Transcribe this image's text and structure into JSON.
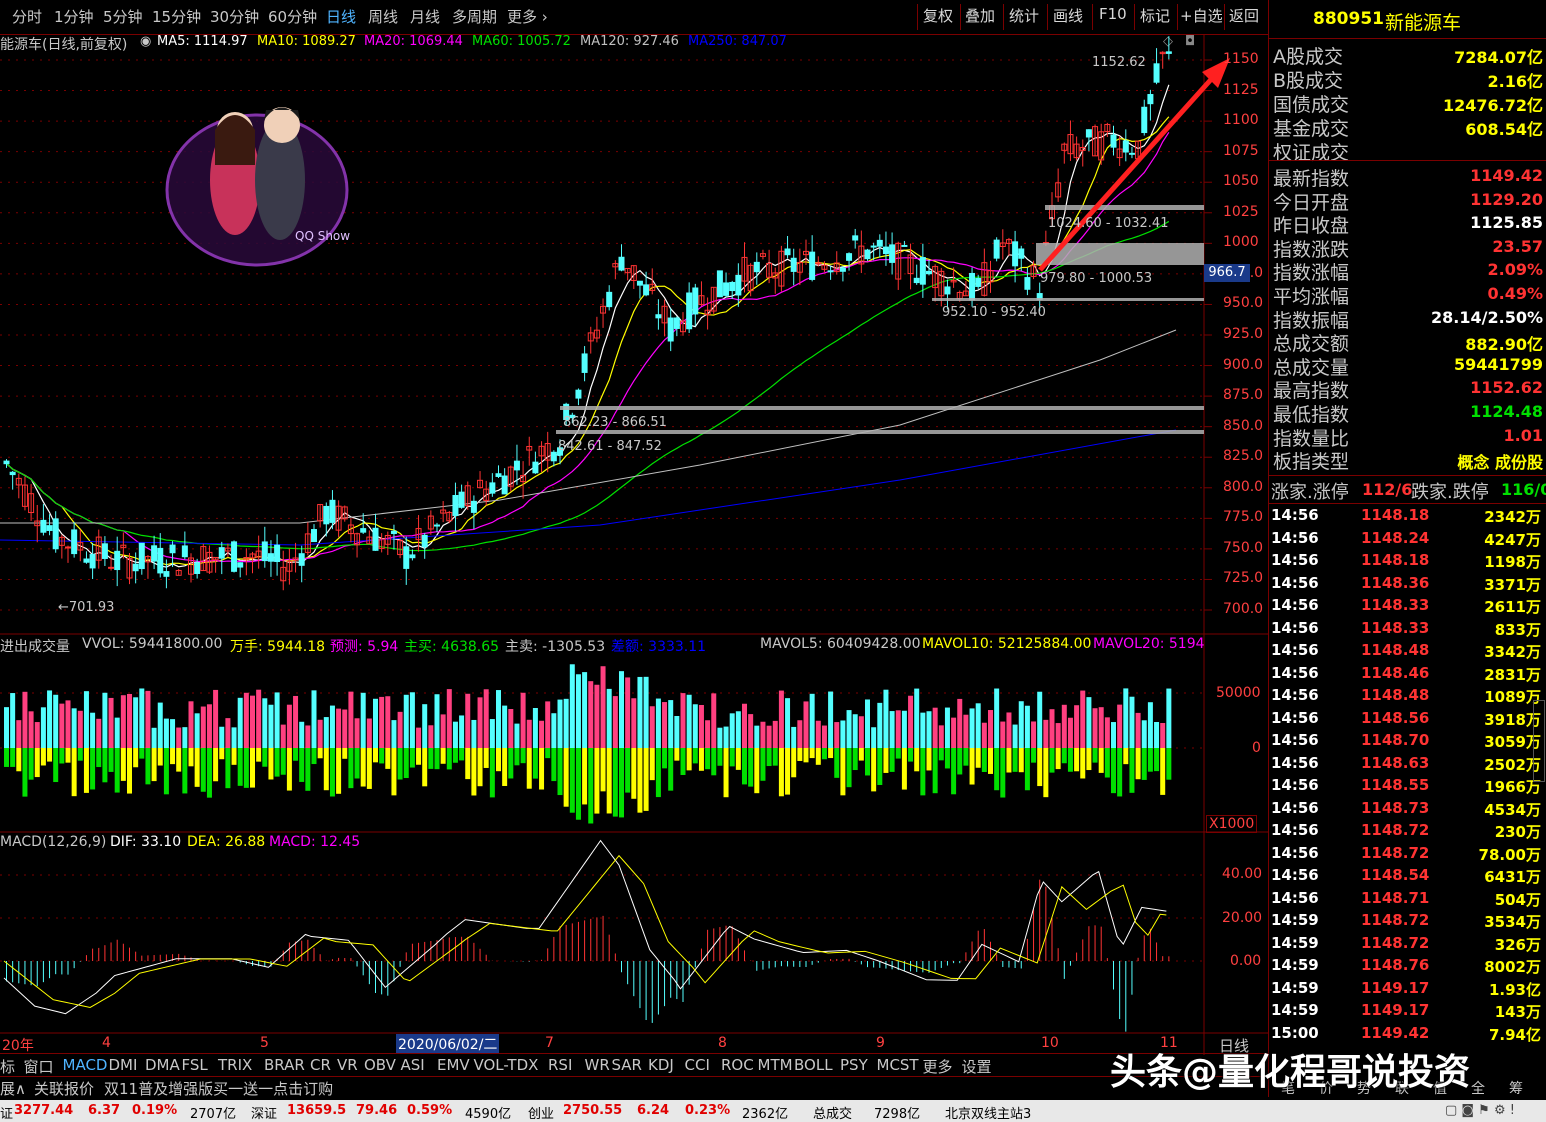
{
  "colors": {
    "up": "#ff3333",
    "down": "#54ffff",
    "ma5": "#ffffff",
    "ma10": "#ffff00",
    "ma20": "#ff00ff",
    "ma60": "#00e000",
    "ma120": "#c0c0c0",
    "ma250": "#0000ff",
    "grid": "#7a0000"
  },
  "topmenu": {
    "items": [
      "分时",
      "1分钟",
      "5分钟",
      "15分钟",
      "30分钟",
      "60分钟",
      "日线",
      "周线",
      "月线",
      "多周期",
      "更多"
    ],
    "active": "日线",
    "right": [
      "复权",
      "叠加",
      "统计",
      "画线",
      "F10",
      "标记",
      "+自选",
      "返回"
    ]
  },
  "main": {
    "title": "能源车(日线,前复权)",
    "ma": [
      {
        "label": "MA5: 1114.97"
      },
      {
        "label": "MA10: 1089.27"
      },
      {
        "label": "MA20: 1069.44"
      },
      {
        "label": "MA60: 1005.72"
      },
      {
        "label": "MA120: 927.46"
      },
      {
        "label": "MA250: 847.07"
      }
    ],
    "price_axis": [
      "1150",
      "1125",
      "1100",
      "1075",
      "1050",
      "1025",
      "1000",
      "975.0",
      "950.0",
      "925.0",
      "900.0",
      "875.0",
      "850.0",
      "825.0",
      "800.0",
      "775.0",
      "750.0",
      "725.0",
      "700.0"
    ],
    "current_price_tag": "966.7",
    "annotations": {
      "high": "1152.62",
      "low": "←701.93",
      "z1": "1024.60 - 1032.41",
      "z2": "979.80 - 1000.53",
      "z3": "952.10 - 952.40",
      "z4": "862.23 - 866.51",
      "z5": "842.61 - 847.52"
    }
  },
  "volume": {
    "title": "进出成交量",
    "vol": "VVOL: 59441800.00",
    "wanshou": "万手: 5944.18",
    "yuce": "预测: 5.94",
    "zhumai": "主买: 4638.65",
    "zhumai2": "主卖: -1305.53",
    "chae": "差额: 3333.11",
    "mavol5": "MAVOL5: 60409428.00",
    "mavol10": "MAVOL10: 52125884.00",
    "mavol20": "MAVOL20: 5194",
    "axis": [
      "50000",
      "0"
    ],
    "unit": "X1000"
  },
  "macd": {
    "title": "MACD(12,26,9)",
    "dif": "DIF: 33.10",
    "dea": "DEA: 26.88",
    "macd": "MACD: 12.45",
    "axis": [
      "40.00",
      "20.00",
      "0.00"
    ]
  },
  "xaxis": {
    "labels": [
      "20年",
      "4",
      "5",
      "2020/06/02/二",
      "7",
      "8",
      "9",
      "10",
      "11"
    ],
    "period": "日线"
  },
  "right_panel": {
    "header": {
      "code": "880951",
      "name": "新能源车"
    },
    "trade": [
      {
        "l": "A股成交",
        "v": "7284.07亿"
      },
      {
        "l": "B股成交",
        "v": "2.16亿"
      },
      {
        "l": "国债成交",
        "v": "12476.72亿"
      },
      {
        "l": "基金成交",
        "v": "608.54亿"
      },
      {
        "l": "权证成交",
        "v": ""
      }
    ],
    "stats": [
      {
        "l": "最新指数",
        "v": "1149.42",
        "c": "#ff3333"
      },
      {
        "l": "今日开盘",
        "v": "1129.20",
        "c": "#ff3333"
      },
      {
        "l": "昨日收盘",
        "v": "1125.85",
        "c": "#ffffff"
      },
      {
        "l": "指数涨跌",
        "v": "23.57",
        "c": "#ff3333"
      },
      {
        "l": "指数涨幅",
        "v": "2.09%",
        "c": "#ff3333"
      },
      {
        "l": "平均涨幅",
        "v": "0.49%",
        "c": "#ff3333"
      },
      {
        "l": "指数振幅",
        "v": "28.14/2.50%",
        "c": "#ffffff"
      },
      {
        "l": "总成交额",
        "v": "882.90亿",
        "c": "#ffff00"
      },
      {
        "l": "总成交量",
        "v": "59441799",
        "c": "#ffff00"
      },
      {
        "l": "最高指数",
        "v": "1152.62",
        "c": "#ff3333"
      },
      {
        "l": "最低指数",
        "v": "1124.48",
        "c": "#00e000"
      },
      {
        "l": "指数量比",
        "v": "1.01",
        "c": "#ff3333"
      },
      {
        "l": "板指类型",
        "v": "概念 成份股",
        "c": "#ffff00"
      }
    ],
    "updown": {
      "l1": "涨家.涨停",
      "v1": "112/6",
      "l2": "跌家.跌停",
      "v2": "116/0"
    },
    "ticks": [
      {
        "t": "14:56",
        "p": "1148.18",
        "v": "2342万"
      },
      {
        "t": "14:56",
        "p": "1148.24",
        "v": "4247万"
      },
      {
        "t": "14:56",
        "p": "1148.18",
        "v": "1198万"
      },
      {
        "t": "14:56",
        "p": "1148.36",
        "v": "3371万"
      },
      {
        "t": "14:56",
        "p": "1148.33",
        "v": "2611万"
      },
      {
        "t": "14:56",
        "p": "1148.33",
        "v": "833万"
      },
      {
        "t": "14:56",
        "p": "1148.48",
        "v": "3342万"
      },
      {
        "t": "14:56",
        "p": "1148.46",
        "v": "2831万"
      },
      {
        "t": "14:56",
        "p": "1148.48",
        "v": "1089万"
      },
      {
        "t": "14:56",
        "p": "1148.56",
        "v": "3918万"
      },
      {
        "t": "14:56",
        "p": "1148.70",
        "v": "3059万"
      },
      {
        "t": "14:56",
        "p": "1148.63",
        "v": "2502万"
      },
      {
        "t": "14:56",
        "p": "1148.55",
        "v": "1966万"
      },
      {
        "t": "14:56",
        "p": "1148.73",
        "v": "4534万"
      },
      {
        "t": "14:56",
        "p": "1148.72",
        "v": "230万"
      },
      {
        "t": "14:56",
        "p": "1148.72",
        "v": "78.00万"
      },
      {
        "t": "14:56",
        "p": "1148.54",
        "v": "6431万"
      },
      {
        "t": "14:56",
        "p": "1148.71",
        "v": "504万"
      },
      {
        "t": "14:59",
        "p": "1148.72",
        "v": "3534万"
      },
      {
        "t": "14:59",
        "p": "1148.72",
        "v": "326万"
      },
      {
        "t": "14:59",
        "p": "1148.76",
        "v": "8002万"
      },
      {
        "t": "14:59",
        "p": "1149.17",
        "v": "1.93亿"
      },
      {
        "t": "14:59",
        "p": "1149.17",
        "v": "143万"
      },
      {
        "t": "15:00",
        "p": "1149.42",
        "v": "7.94亿"
      }
    ],
    "bottom_buttons": [
      "笔",
      "价",
      "势",
      "联",
      "值",
      "全",
      "筹"
    ]
  },
  "indicator_tabs": [
    "标",
    "窗口",
    "MACD",
    "DMI",
    "DMA",
    "FSL",
    "TRIX",
    "BRAR",
    "CR",
    "VR",
    "OBV",
    "ASI",
    "EMV",
    "VOL-TDX",
    "RSI",
    "WR",
    "SAR",
    "KDJ",
    "CCI",
    "ROC",
    "MTM",
    "BOLL",
    "PSY",
    "MCST",
    "更多",
    "设置"
  ],
  "bottom_bar": {
    "expand": "展∧",
    "related": "关联报价",
    "promo": "双11普及增强版买一送一点击订购"
  },
  "status": {
    "sh_label": "证",
    "sh_val": "3277.44",
    "sh_chg": "6.37",
    "sh_pct": "0.19%",
    "sh_amt": "2707亿",
    "sz_label": "深证",
    "sz_val": "13659.5",
    "sz_chg": "79.46",
    "sz_pct": "0.59%",
    "sz_amt": "4590亿",
    "cy_label": "创业",
    "cy_val": "2750.55",
    "cy_chg": "6.24",
    "cy_pct": "0.23%",
    "cy_amt": "2362亿",
    "total_label": "总成交",
    "total_val": "7298亿",
    "server": "北京双线主站3"
  },
  "watermark": "头条@量化程哥说投资"
}
